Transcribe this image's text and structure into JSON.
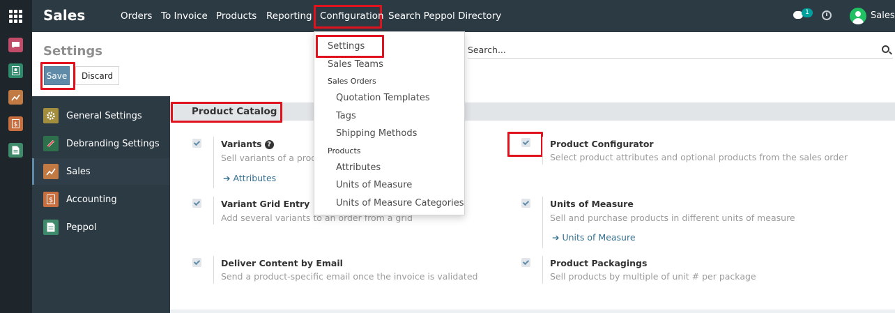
{
  "navbar": {
    "app_title": "Sales",
    "menu": [
      "Orders",
      "To Invoice",
      "Products",
      "Reporting",
      "Configuration",
      "Search Peppol Directory"
    ],
    "chat_count": "1",
    "user_name": "Sales"
  },
  "control_panel": {
    "title": "Settings",
    "save_label": "Save",
    "discard_label": "Discard",
    "search_placeholder": "Search..."
  },
  "sidebar": {
    "items": [
      {
        "label": "General Settings",
        "icon": "gear-icon",
        "color": "#a38e3f"
      },
      {
        "label": "Debranding Settings",
        "icon": "debranding-icon",
        "color": "#2e6f4c"
      },
      {
        "label": "Sales",
        "icon": "chart-icon",
        "color": "#c27a45"
      },
      {
        "label": "Accounting",
        "icon": "dollar-doc-icon",
        "color": "#c96e3f"
      },
      {
        "label": "Peppol",
        "icon": "document-icon",
        "color": "#3f8a6a"
      }
    ]
  },
  "section": {
    "title": "Product Catalog"
  },
  "options": {
    "variants": {
      "title": "Variants",
      "desc": "Sell variants of a produ",
      "link": "Attributes"
    },
    "product_configurator": {
      "title": "Product Configurator",
      "desc": "Select product attributes and optional products from the sales order"
    },
    "variant_grid": {
      "title": "Variant Grid Entry",
      "desc": "Add several variants to an order from a grid"
    },
    "units_of_measure": {
      "title": "Units of Measure",
      "desc": "Sell and purchase products in different units of measure",
      "link": "Units of Measure"
    },
    "deliver_content": {
      "title": "Deliver Content by Email",
      "desc": "Send a product-specific email once the invoice is validated"
    },
    "product_packagings": {
      "title": "Product Packagings",
      "desc": "Sell products by multiple of unit # per package"
    }
  },
  "dropdown": {
    "settings": "Settings",
    "sales_teams": "Sales Teams",
    "sales_orders_header": "Sales Orders",
    "quotation_templates": "Quotation Templates",
    "tags": "Tags",
    "shipping_methods": "Shipping Methods",
    "products_header": "Products",
    "attributes": "Attributes",
    "units_of_measure": "Units of Measure",
    "uom_categories": "Units of Measure Categories"
  },
  "colors": {
    "navbar": "#2c3a44",
    "accent": "#5f8ba8",
    "highlight": "#e0121d"
  }
}
